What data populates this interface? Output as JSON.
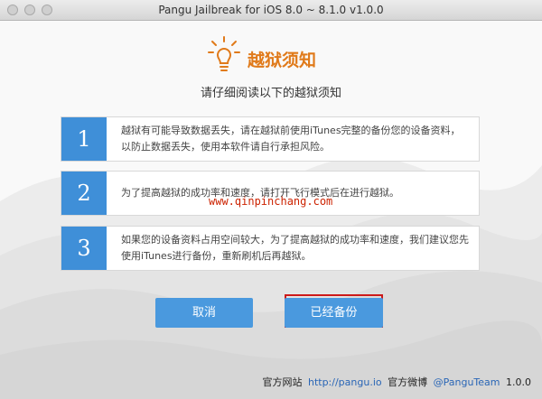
{
  "window": {
    "title": "Pangu Jailbreak for iOS 8.0 ~ 8.1.0  v1.0.0"
  },
  "header": {
    "icon": "lightbulb-icon",
    "title": "越狱须知",
    "subtitle": "请仔细阅读以下的越狱须知",
    "accent": "#e07a1a"
  },
  "steps": [
    {
      "num": "1",
      "text": "越狱有可能导致数据丢失，请在越狱前使用iTunes完整的备份您的设备资料，以防止数据丢失，使用本软件请自行承担风险。"
    },
    {
      "num": "2",
      "text": "为了提高越狱的成功率和速度，请打开飞行模式后在进行越狱。"
    },
    {
      "num": "3",
      "text": "如果您的设备资料占用空间较大，为了提高越狱的成功率和速度，我们建议您先使用iTunes进行备份，重新刷机后再越狱。"
    }
  ],
  "watermark": "www.qinpinchang.com",
  "buttons": {
    "cancel": "取消",
    "confirm": "已经备份"
  },
  "footer": {
    "site_label": "官方网站",
    "site_url": "http://pangu.io",
    "weibo_label": "官方微博",
    "weibo_handle": "@PanguTeam",
    "version": "1.0.0"
  },
  "colors": {
    "step_blue": "#3f8fd8",
    "button_blue": "#4a99de",
    "highlight_red": "#cc1a1a"
  }
}
